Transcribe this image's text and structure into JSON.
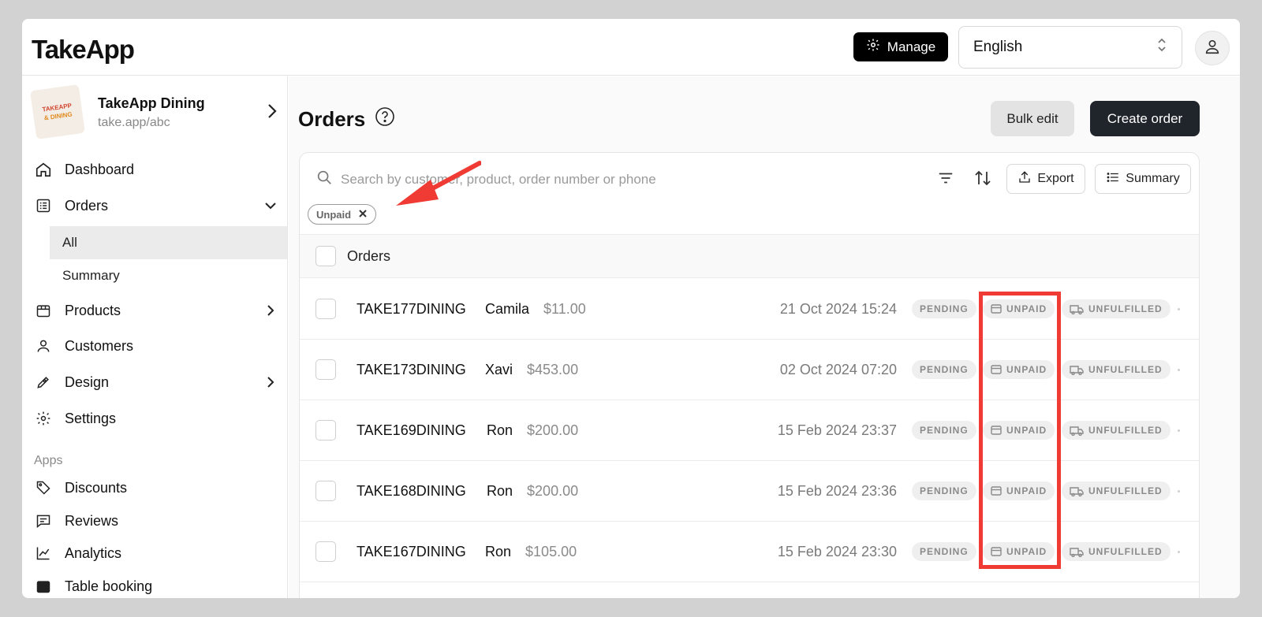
{
  "header": {
    "logo": "TakeApp",
    "manage_label": "Manage",
    "language": "English"
  },
  "store": {
    "name": "TakeApp Dining",
    "url": "take.app/abc",
    "logo_line1": "TAKEAPP",
    "logo_line2": "& DINING"
  },
  "sidebar": {
    "items": [
      {
        "label": "Dashboard"
      },
      {
        "label": "Orders"
      },
      {
        "label": "Products"
      },
      {
        "label": "Customers"
      },
      {
        "label": "Design"
      },
      {
        "label": "Settings"
      }
    ],
    "orders_sub": [
      "All",
      "Summary"
    ],
    "apps_label": "Apps",
    "apps": [
      "Discounts",
      "Reviews",
      "Analytics",
      "Table booking"
    ]
  },
  "main": {
    "title": "Orders",
    "bulk_edit": "Bulk edit",
    "create_order": "Create order",
    "search_placeholder": "Search by customer, product, order number or phone",
    "export": "Export",
    "summary": "Summary",
    "filter_chip": "Unpaid",
    "table_header": "Orders"
  },
  "orders": [
    {
      "number": "TAKE177DINING",
      "customer": "Camila",
      "amount": "$11.00",
      "date": "21 Oct 2024 15:24",
      "status": "PENDING",
      "payment": "UNPAID",
      "fulfillment": "UNFULFILLED"
    },
    {
      "number": "TAKE173DINING",
      "customer": "Xavi",
      "amount": "$453.00",
      "date": "02 Oct 2024 07:20",
      "status": "PENDING",
      "payment": "UNPAID",
      "fulfillment": "UNFULFILLED"
    },
    {
      "number": "TAKE169DINING",
      "customer": "Ron",
      "amount": "$200.00",
      "date": "15 Feb 2024 23:37",
      "status": "PENDING",
      "payment": "UNPAID",
      "fulfillment": "UNFULFILLED"
    },
    {
      "number": "TAKE168DINING",
      "customer": "Ron",
      "amount": "$200.00",
      "date": "15 Feb 2024 23:36",
      "status": "PENDING",
      "payment": "UNPAID",
      "fulfillment": "UNFULFILLED"
    },
    {
      "number": "TAKE167DINING",
      "customer": "Ron",
      "amount": "$105.00",
      "date": "15 Feb 2024 23:30",
      "status": "PENDING",
      "payment": "UNPAID",
      "fulfillment": "UNFULFILLED"
    }
  ],
  "colors": {
    "highlight": "#ef3b33",
    "primary_button": "#20242b",
    "manage_button": "#000000"
  }
}
